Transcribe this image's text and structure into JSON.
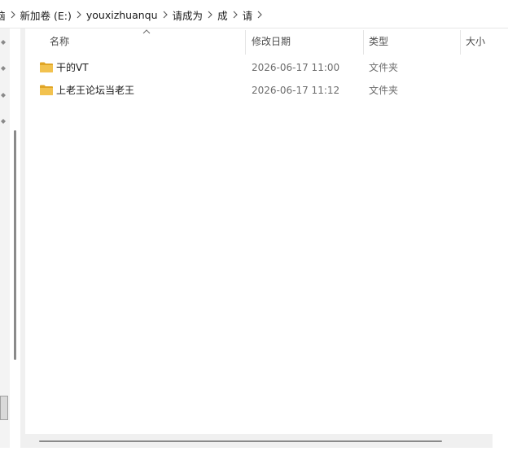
{
  "breadcrumb": {
    "items": [
      "脑",
      "新加卷 (E:)",
      "youxizhuanqu",
      "请成为",
      "成",
      "请"
    ]
  },
  "columns": {
    "name": "名称",
    "date": "修改日期",
    "type": "类型",
    "size": "大小"
  },
  "files": [
    {
      "name": "干的VT",
      "date": "2026-06-17 11:00",
      "type": "文件夹",
      "icon": "folder-icon"
    },
    {
      "name": "上老王论坛当老王",
      "date": "2026-06-17 11:12",
      "type": "文件夹",
      "icon": "folder-icon"
    }
  ],
  "colors": {
    "folder": "#f2c24f",
    "folder_dark": "#e0a526"
  }
}
